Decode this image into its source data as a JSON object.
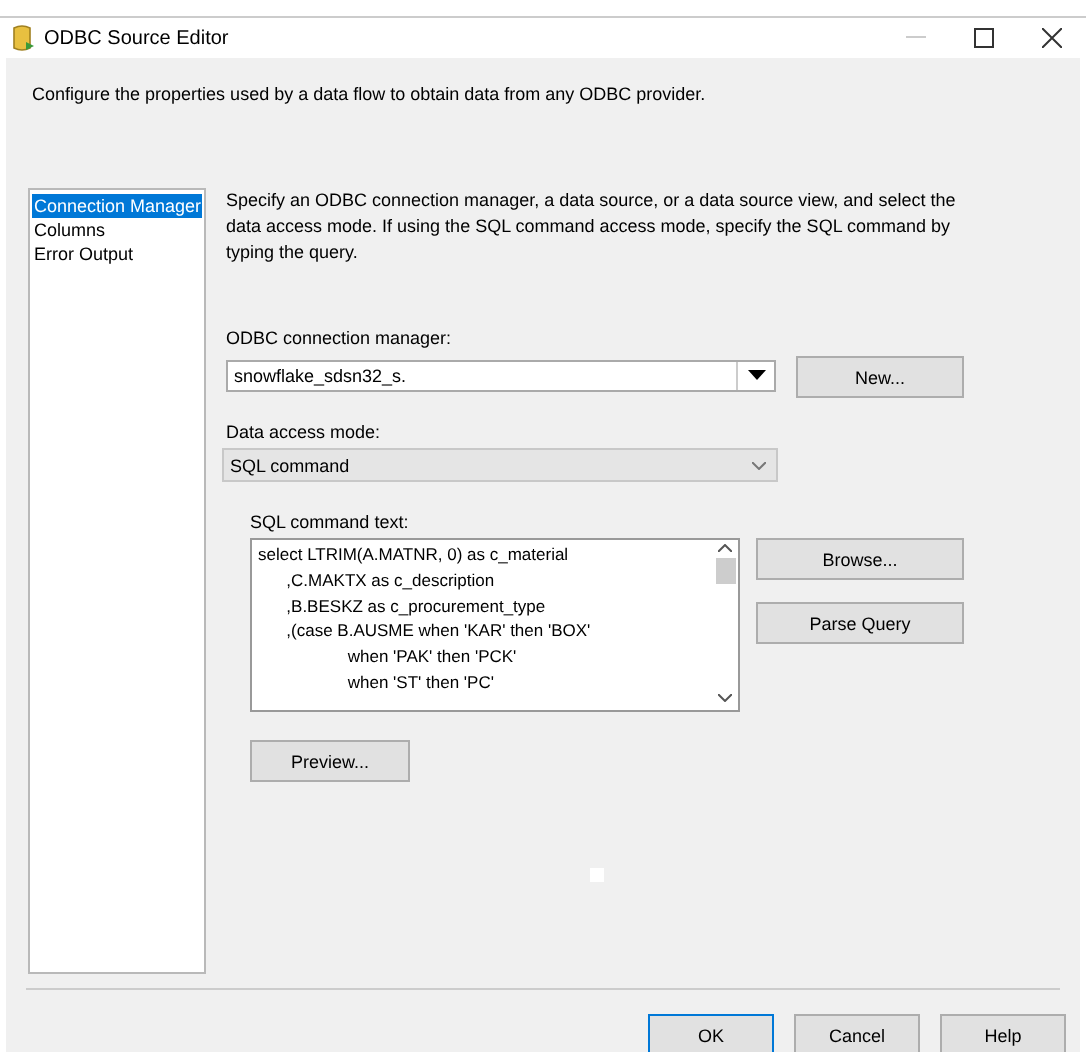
{
  "window": {
    "title": "ODBC Source Editor"
  },
  "description": "Configure the properties used by a data flow to obtain data from any ODBC provider.",
  "nav": [
    {
      "label": "Connection Manager",
      "selected": true
    },
    {
      "label": "Columns",
      "selected": false
    },
    {
      "label": "Error Output",
      "selected": false
    }
  ],
  "intro": "Specify an ODBC connection manager, a data source, or a data source view, and select the data access mode. If using the SQL command access mode, specify the SQL command by typing the query.",
  "connection_manager": {
    "label": "ODBC connection manager:",
    "value": "snowflake_sdsn32_s."
  },
  "new_button": "New...",
  "access_mode": {
    "label": "Data access mode:",
    "value": "SQL command"
  },
  "sql": {
    "label": "SQL command text:",
    "text": "select LTRIM(A.MATNR, 0) as c_material\n      ,C.MAKTX as c_description\n      ,B.BESKZ as c_procurement_type\n      ,(case B.AUSME when 'KAR' then 'BOX'\n                   when 'PAK' then 'PCK'\n                   when 'ST' then 'PC'"
  },
  "side_buttons": [
    "Browse...",
    "Parse Query"
  ],
  "preview_button": "Preview...",
  "footer_buttons": [
    {
      "label": "OK",
      "selected": true
    },
    {
      "label": "Cancel",
      "selected": false
    },
    {
      "label": "Help",
      "selected": false
    }
  ]
}
